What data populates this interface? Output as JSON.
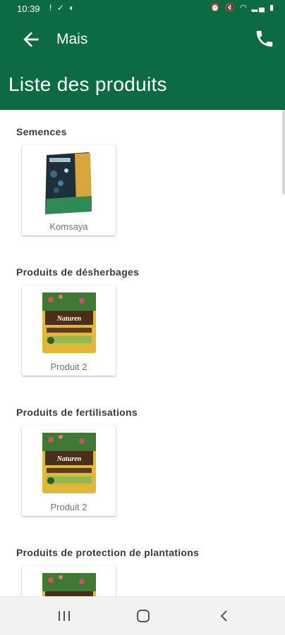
{
  "status_bar": {
    "time": "10:39",
    "left_icons": [
      "notification-icon",
      "check-icon",
      "data-saver-icon"
    ],
    "right_icons": [
      "alarm-icon",
      "mute-icon",
      "wifi-icon",
      "signal-icon",
      "battery-icon"
    ]
  },
  "app_bar": {
    "title": "Mais",
    "page_title": "Liste des produits",
    "background_color": "#0c6b40"
  },
  "sections": [
    {
      "title": "Semences",
      "products": [
        {
          "name": "Komsaya",
          "image": "seed-bag-image"
        }
      ]
    },
    {
      "title": "Produits de désherbages",
      "products": [
        {
          "name": "Produit 2",
          "image": "naturen-bag-image"
        }
      ]
    },
    {
      "title": "Produits de fertilisations",
      "products": [
        {
          "name": "Produit 2",
          "image": "naturen-bag-image"
        }
      ]
    },
    {
      "title": "Produits de protection de plantations",
      "products": [
        {
          "name": "",
          "image": "naturen-bag-image"
        }
      ]
    }
  ],
  "nav_bar": {
    "buttons": [
      "recents-icon",
      "home-icon",
      "back-icon"
    ]
  }
}
